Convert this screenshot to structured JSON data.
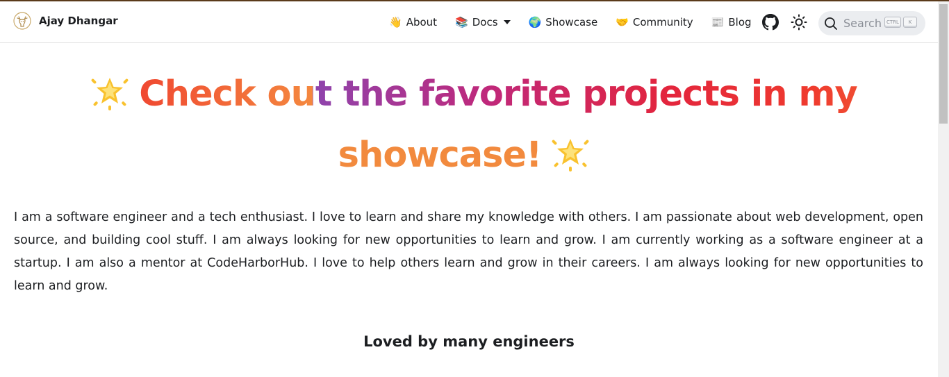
{
  "brand": {
    "title": "Ajay Dhangar",
    "logo_icon": "deer-logo-icon"
  },
  "nav": {
    "items": [
      {
        "emoji": "👋",
        "label": "About",
        "icon": "waving-hand-icon"
      },
      {
        "emoji": "📚",
        "label": "Docs",
        "icon": "books-icon",
        "dropdown": true
      },
      {
        "emoji": "🌍",
        "label": "Showcase",
        "icon": "globe-icon"
      },
      {
        "emoji": "🤝",
        "label": "Community",
        "icon": "handshake-icon"
      },
      {
        "emoji": "📰",
        "label": "Blog",
        "icon": "newspaper-icon"
      }
    ],
    "github_icon": "github-icon",
    "theme_icon": "sun-icon"
  },
  "search": {
    "placeholder": "Search",
    "key1": "CTRL",
    "key2": "K"
  },
  "hero": {
    "line1": "Check out the favorite projects in my",
    "line2": "showcase!",
    "star_icon": "glowing-star-icon"
  },
  "intro": {
    "text": "I am a software engineer and a tech enthusiast. I love to learn and share my knowledge with others. I am passionate about web development, open source, and building cool stuff. I am always looking for new opportunities to learn and grow. I am currently working as a software engineer at a startup. I am also a mentor at CodeHarborHub. I love to help others learn and grow in their careers. I am always looking for new opportunities to learn and grow."
  },
  "section": {
    "heading": "Loved by many engineers"
  },
  "colors": {
    "gradient_start": "#8e44ad",
    "gradient_mid": "#e3253d",
    "gradient_end": "#f4883f",
    "search_bg": "#ebedf0"
  }
}
